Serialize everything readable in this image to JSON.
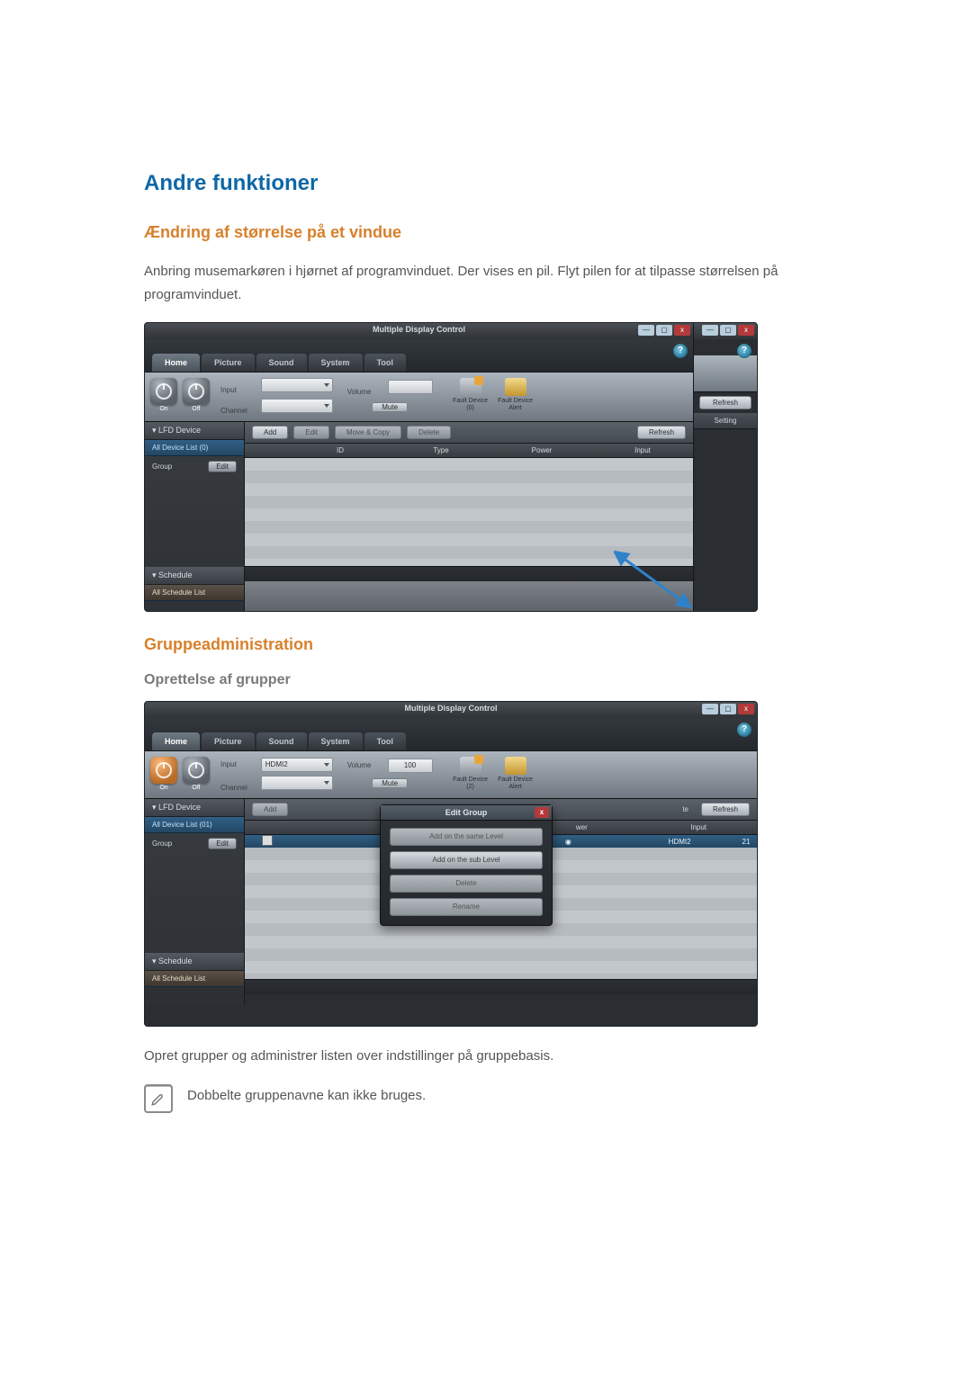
{
  "headings": {
    "other": "Andre funktioner",
    "resize": "Ændring af størrelse på et vindue",
    "resize_body": "Anbring musemarkøren i hjørnet af programvinduet. Der vises en pil. Flyt pilen for at tilpasse størrelsen på programvinduet.",
    "group_admin": "Gruppeadministration",
    "group_create": "Oprettelse af grupper",
    "group_body": "Opret grupper og administrer listen over indstillinger på gruppebasis.",
    "note": "Dobbelte gruppenavne kan ikke bruges."
  },
  "mdc": {
    "title": "Multiple Display Control",
    "tabs": {
      "home": "Home",
      "picture": "Picture",
      "sound": "Sound",
      "system": "System",
      "tool": "Tool"
    },
    "ribbon": {
      "on": "On",
      "off": "Off",
      "input": "Input",
      "channel": "Channel",
      "volume": "Volume",
      "mute": "Mute",
      "fault_device_0": "Fault Device (0)",
      "fault_device_2": "Fault Device (2)",
      "fault_alert": "Fault Device Alert",
      "input_val": "HDMI2",
      "volume_val": "100"
    },
    "nav": {
      "lfd": "LFD Device",
      "all0": "All Device List (0)",
      "all01": "All Device List (01)",
      "group": "Group",
      "edit": "Edit",
      "schedule": "Schedule",
      "all_sched": "All Schedule List"
    },
    "tool": {
      "add": "Add",
      "edit": "Edit",
      "movecopy": "Move & Copy",
      "delete": "Delete",
      "refresh": "Refresh",
      "setting": "Setting"
    },
    "thead": {
      "id": "ID",
      "type": "Type",
      "power": "Power",
      "input": "Input"
    },
    "row": {
      "type": "",
      "power": "",
      "input": "HDMI2",
      "val": "21"
    },
    "popup": {
      "title": "Edit Group",
      "same": "Add on the same Level",
      "sub": "Add on the sub Level",
      "delete": "Delete",
      "rename": "Rename"
    }
  }
}
